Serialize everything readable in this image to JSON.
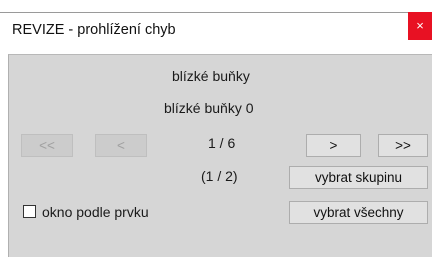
{
  "window": {
    "title": "REVIZE - prohlížení chyb",
    "close_glyph": "×",
    "close_color": "#e81123"
  },
  "panel": {
    "heading": "blízké buňky",
    "subheading": "blízké buňky 0",
    "page_counter": "1 / 6",
    "group_counter": "(1 / 2)",
    "buttons": {
      "first": "<<",
      "prev": "<",
      "next": ">",
      "last": ">>",
      "select_group": "vybrat skupinu",
      "select_all": "vybrat všechny"
    },
    "checkbox": {
      "label": "okno podle prvku",
      "checked": false
    }
  }
}
